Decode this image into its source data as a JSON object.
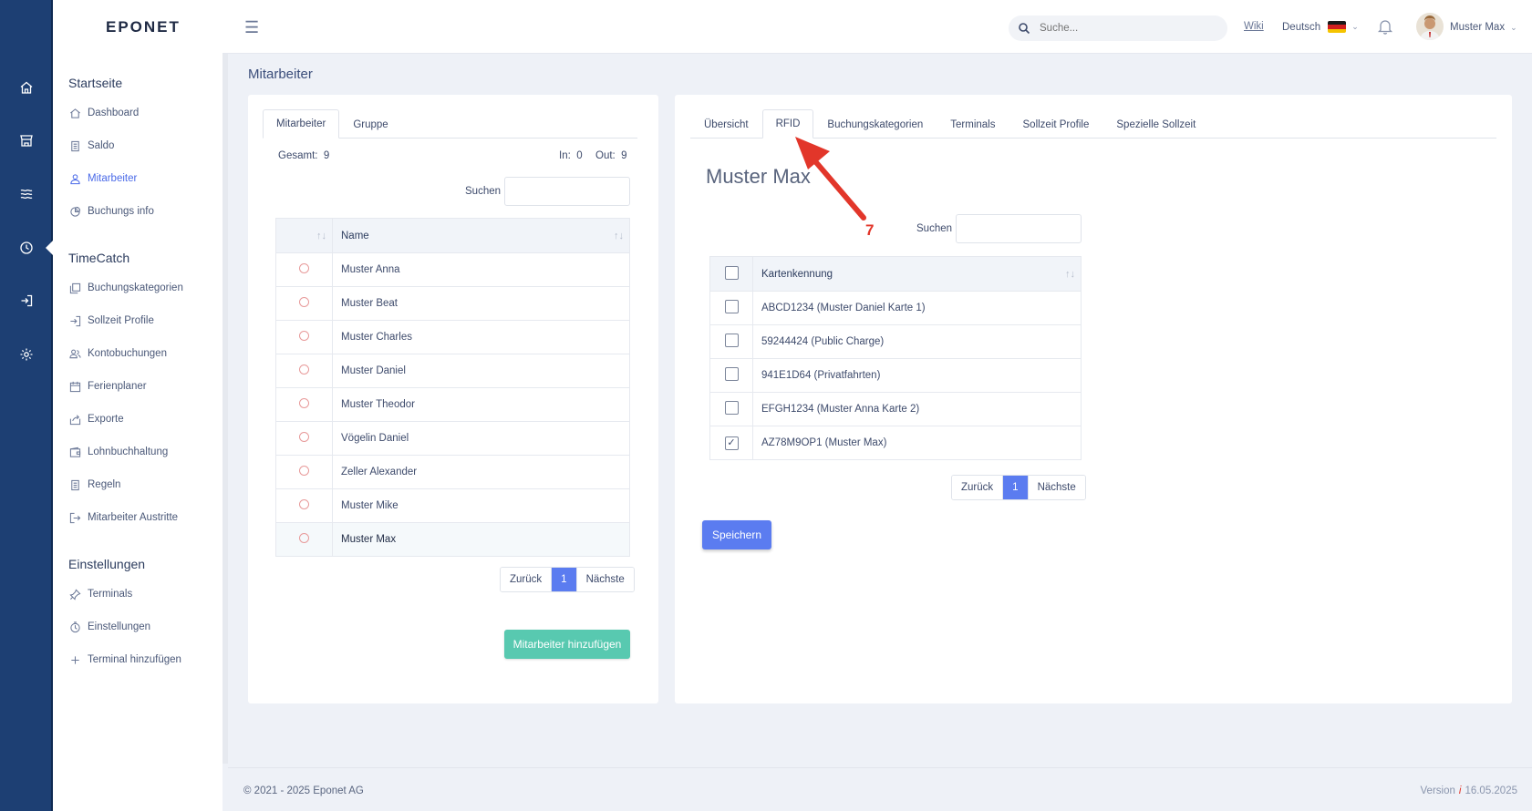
{
  "app": {
    "logo": "EPONET"
  },
  "rail": {
    "icons": [
      "home-icon",
      "store-icon",
      "waves-icon",
      "clock-icon",
      "login-icon",
      "settings-icon"
    ]
  },
  "sidebar": {
    "sections": [
      {
        "title": "Startseite",
        "items": [
          {
            "label": "Dashboard",
            "icon": "home-icon"
          },
          {
            "label": "Saldo",
            "icon": "document-icon"
          },
          {
            "label": "Mitarbeiter",
            "icon": "user-icon",
            "active": true
          },
          {
            "label": "Buchungs info",
            "icon": "pie-icon"
          }
        ]
      },
      {
        "title": "TimeCatch",
        "items": [
          {
            "label": "Buchungskategorien",
            "icon": "copy-icon"
          },
          {
            "label": "Sollzeit Profile",
            "icon": "login-icon"
          },
          {
            "label": "Kontobuchungen",
            "icon": "users-icon"
          },
          {
            "label": "Ferienplaner",
            "icon": "calendar-icon"
          },
          {
            "label": "Exporte",
            "icon": "share-icon"
          },
          {
            "label": "Lohnbuchhaltung",
            "icon": "wallet-icon"
          },
          {
            "label": "Regeln",
            "icon": "document-icon"
          },
          {
            "label": "Mitarbeiter Austritte",
            "icon": "logout-icon"
          }
        ]
      },
      {
        "title": "Einstellungen",
        "items": [
          {
            "label": "Terminals",
            "icon": "pin-icon"
          },
          {
            "label": "Einstellungen",
            "icon": "timer-icon"
          },
          {
            "label": "Terminal hinzufügen",
            "icon": "plus-icon"
          }
        ]
      }
    ]
  },
  "topbar": {
    "search_placeholder": "Suche...",
    "wiki": "Wiki",
    "language": "Deutsch",
    "user": "Muster Max"
  },
  "page": {
    "title": "Mitarbeiter"
  },
  "left_card": {
    "tabs": [
      "Mitarbeiter",
      "Gruppe"
    ],
    "active_tab": 0,
    "stats": {
      "total_label": "Gesamt:",
      "total": "9",
      "in_label": "In:",
      "in": "0",
      "out_label": "Out:",
      "out": "9"
    },
    "search_label": "Suchen",
    "table": {
      "header": "Name",
      "rows": [
        "Muster Anna",
        "Muster Beat",
        "Muster Charles",
        "Muster Daniel",
        "Muster Theodor",
        "Vögelin Daniel",
        "Zeller Alexander",
        "Muster Mike",
        "Muster Max"
      ],
      "selected_row": 8
    },
    "pager": {
      "prev": "Zurück",
      "current": "1",
      "next": "Nächste"
    },
    "add_button": "Mitarbeiter hinzufügen"
  },
  "right_card": {
    "tabs": [
      "Übersicht",
      "RFID",
      "Buchungskategorien",
      "Terminals",
      "Sollzeit Profile",
      "Spezielle Sollzeit"
    ],
    "active_tab": 1,
    "person_name": "Muster Max",
    "search_label": "Suchen",
    "table": {
      "header": "Kartenkennung",
      "rows": [
        {
          "label": "ABCD1234 (Muster Daniel Karte 1)",
          "checked": false
        },
        {
          "label": "59244424 (Public Charge)",
          "checked": false
        },
        {
          "label": "941E1D64 (Privatfahrten)",
          "checked": false
        },
        {
          "label": "EFGH1234 (Muster Anna Karte 2)",
          "checked": false
        },
        {
          "label": "AZ78M9OP1 (Muster Max)",
          "checked": true
        }
      ]
    },
    "pager": {
      "prev": "Zurück",
      "current": "1",
      "next": "Nächste"
    },
    "save_button": "Speichern"
  },
  "annotation": {
    "number": "7",
    "color": "#e2362a"
  },
  "footer": {
    "copyright": "© 2021 - 2025 Eponet AG",
    "version_label": "Version",
    "version_date": "16.05.2025"
  }
}
